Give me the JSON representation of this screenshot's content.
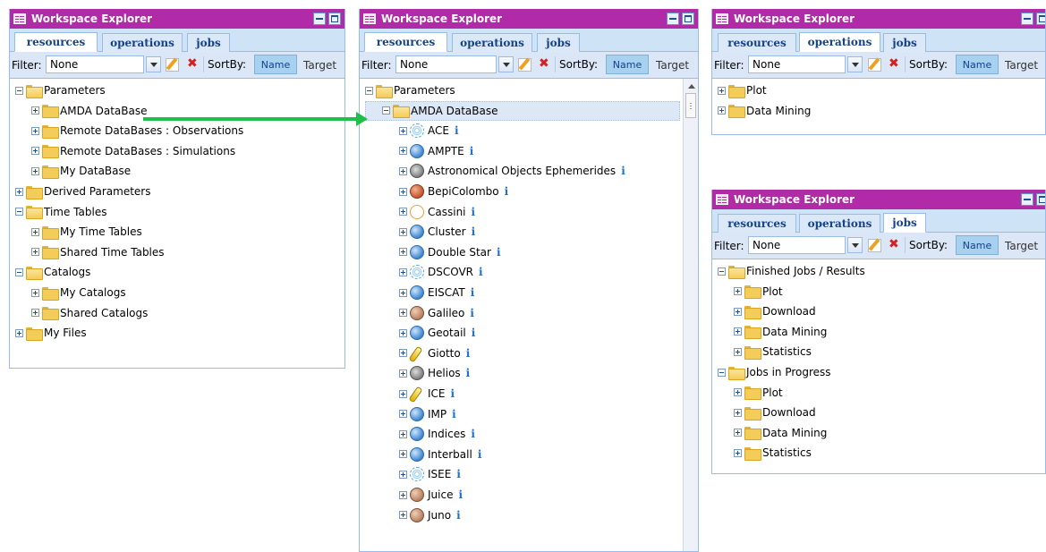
{
  "window_title": "Workspace Explorer",
  "tabs": {
    "resources": "resources",
    "operations": "operations",
    "jobs": "jobs"
  },
  "filter": {
    "label": "Filter:",
    "value": "None",
    "sort_by_label": "SortBy:",
    "sort_name": "Name",
    "sort_target": "Target"
  },
  "panel1": {
    "tree": [
      {
        "label": "Parameters",
        "level": 0,
        "expanded": true
      },
      {
        "label": "AMDA DataBase",
        "level": 1
      },
      {
        "label": "Remote DataBases : Observations",
        "level": 1
      },
      {
        "label": "Remote DataBases : Simulations",
        "level": 1
      },
      {
        "label": "My DataBase",
        "level": 1
      },
      {
        "label": "Derived Parameters",
        "level": 0
      },
      {
        "label": "Time Tables",
        "level": 0,
        "expanded": true
      },
      {
        "label": "My Time Tables",
        "level": 1
      },
      {
        "label": "Shared Time Tables",
        "level": 1
      },
      {
        "label": "Catalogs",
        "level": 0,
        "expanded": true
      },
      {
        "label": "My Catalogs",
        "level": 1
      },
      {
        "label": "Shared Catalogs",
        "level": 1
      },
      {
        "label": "My Files",
        "level": 0
      }
    ]
  },
  "panel2": {
    "root": "Parameters",
    "database": "AMDA DataBase",
    "missions": [
      {
        "label": "ACE",
        "icon": "orbit"
      },
      {
        "label": "AMPTE",
        "icon": "globe"
      },
      {
        "label": "Astronomical Objects Ephemerides",
        "icon": "gray"
      },
      {
        "label": "BepiColombo",
        "icon": "red"
      },
      {
        "label": "Cassini",
        "icon": "cassini"
      },
      {
        "label": "Cluster",
        "icon": "globe"
      },
      {
        "label": "Double Star",
        "icon": "globe"
      },
      {
        "label": "DSCOVR",
        "icon": "orbit"
      },
      {
        "label": "EISCAT",
        "icon": "globe"
      },
      {
        "label": "Galileo",
        "icon": "brown"
      },
      {
        "label": "Geotail",
        "icon": "globe"
      },
      {
        "label": "Giotto",
        "icon": "comet"
      },
      {
        "label": "Helios",
        "icon": "gray"
      },
      {
        "label": "ICE",
        "icon": "comet"
      },
      {
        "label": "IMP",
        "icon": "globe"
      },
      {
        "label": "Indices",
        "icon": "globe"
      },
      {
        "label": "Interball",
        "icon": "globe"
      },
      {
        "label": "ISEE",
        "icon": "orbit"
      },
      {
        "label": "Juice",
        "icon": "brown"
      },
      {
        "label": "Juno",
        "icon": "brown"
      }
    ],
    "info_glyph": "i"
  },
  "panel3": {
    "tree": [
      {
        "label": "Plot"
      },
      {
        "label": "Data Mining"
      }
    ]
  },
  "panel4": {
    "tree": [
      {
        "label": "Finished Jobs / Results",
        "level": 0,
        "expanded": true
      },
      {
        "label": "Plot",
        "level": 1
      },
      {
        "label": "Download",
        "level": 1
      },
      {
        "label": "Data Mining",
        "level": 1
      },
      {
        "label": "Statistics",
        "level": 1
      },
      {
        "label": "Jobs in Progress",
        "level": 0,
        "expanded": true
      },
      {
        "label": "Plot",
        "level": 1
      },
      {
        "label": "Download",
        "level": 1
      },
      {
        "label": "Data Mining",
        "level": 1
      },
      {
        "label": "Statistics",
        "level": 1
      }
    ]
  }
}
